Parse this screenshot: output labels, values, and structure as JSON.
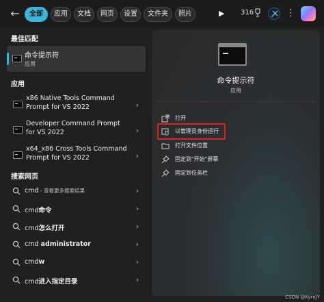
{
  "topbar": {
    "filters": [
      {
        "label": "全部",
        "active": true
      },
      {
        "label": "应用"
      },
      {
        "label": "文档"
      },
      {
        "label": "网页"
      },
      {
        "label": "设置"
      },
      {
        "label": "文件夹"
      },
      {
        "label": "照片"
      }
    ],
    "points": "316"
  },
  "left": {
    "best_match_title": "最佳匹配",
    "best_match": {
      "title": "命令提示符",
      "subtitle": "应用"
    },
    "apps_title": "应用",
    "apps": [
      {
        "label": "x86 Native Tools Command Prompt for VS 2022"
      },
      {
        "label": "Developer Command Prompt for VS 2022"
      },
      {
        "label": "x64_x86 Cross Tools Command Prompt for VS 2022"
      }
    ],
    "web_title": "搜索网页",
    "web": [
      {
        "prefix": "cmd",
        "bold": "",
        "sub": " - 查看更多搜索结果"
      },
      {
        "prefix": "cmd",
        "bold": "命令",
        "sub": ""
      },
      {
        "prefix": "cmd",
        "bold": "怎么打开",
        "sub": ""
      },
      {
        "prefix": "cmd ",
        "bold": "administrator",
        "sub": ""
      },
      {
        "prefix": "cmd",
        "bold": "w",
        "sub": ""
      },
      {
        "prefix": "cmd",
        "bold": "进入指定目录",
        "sub": ""
      }
    ]
  },
  "right": {
    "app_name": "命令提示符",
    "app_type": "应用",
    "actions": [
      {
        "label": "打开"
      },
      {
        "label": "以管理员身份运行"
      },
      {
        "label": "打开文件位置"
      },
      {
        "label": "固定到\"开始\"屏幕"
      },
      {
        "label": "固定到任务栏"
      }
    ]
  },
  "watermark": "CSDN @KyroJY",
  "colors": {
    "accent": "#3fb6d8",
    "highlight_box": "#e02020"
  }
}
